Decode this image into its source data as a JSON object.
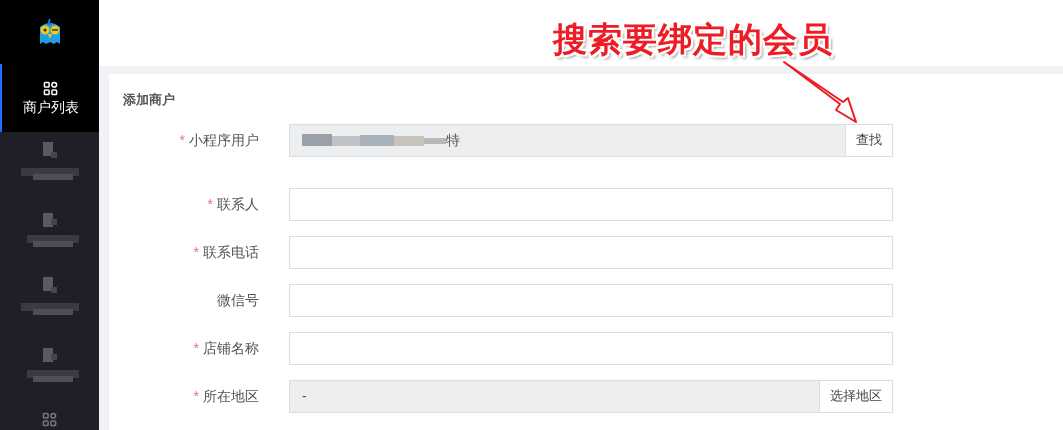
{
  "sidebar": {
    "items": [
      {
        "kind": "menu",
        "label": "商户列表",
        "selected": true
      },
      {
        "kind": "redacted",
        "selected": false
      },
      {
        "kind": "redacted",
        "selected": false
      },
      {
        "kind": "redacted",
        "selected": false
      },
      {
        "kind": "redacted",
        "selected": false
      },
      {
        "kind": "partial",
        "selected": false
      }
    ]
  },
  "form": {
    "title": "添加商户",
    "fields": [
      {
        "marker": "*",
        "label": "小程序用户",
        "kind": "picker",
        "value": "特",
        "redacted": true,
        "button": "查找"
      },
      {
        "marker": "*",
        "label": "联系人",
        "kind": "text"
      },
      {
        "marker": "*",
        "label": "联系电话",
        "kind": "text"
      },
      {
        "label": "微信号",
        "kind": "text"
      },
      {
        "marker": "*",
        "label": "店铺名称",
        "kind": "text"
      },
      {
        "marker": "*",
        "label": "所在地区",
        "kind": "picker",
        "value": "-",
        "button": "选择地区"
      }
    ]
  },
  "annotation": {
    "text": "搜索要绑定的会员"
  }
}
